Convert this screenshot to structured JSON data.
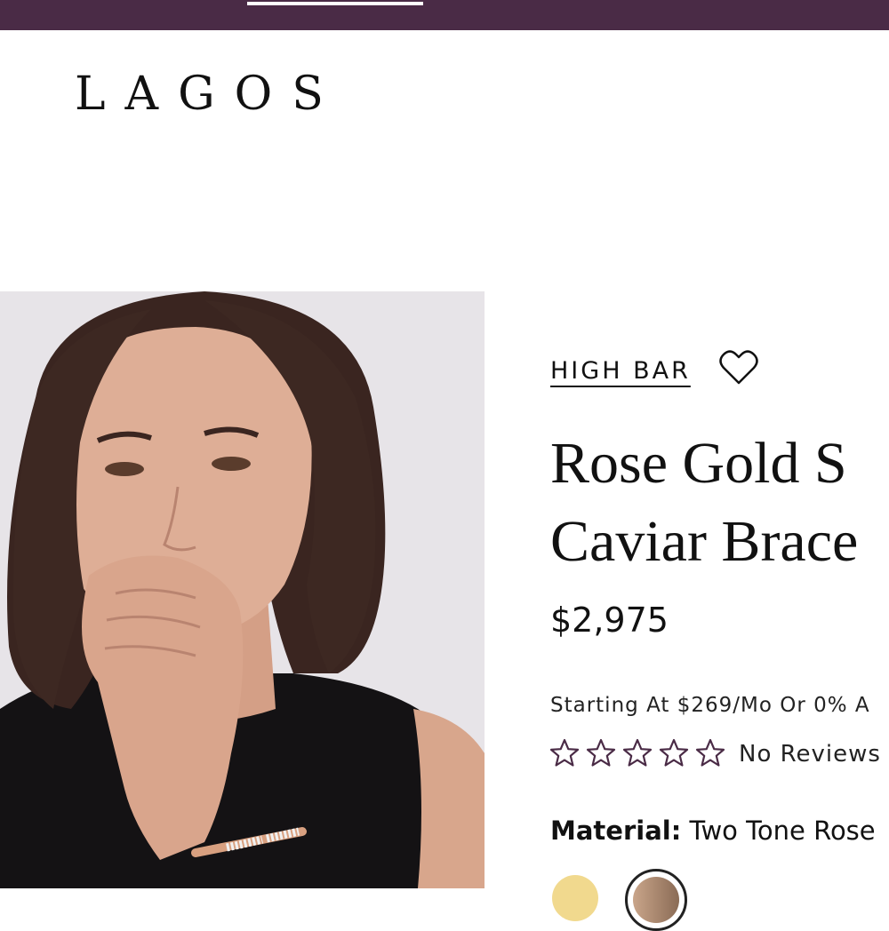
{
  "header": {
    "logo_text": "LAGOS",
    "bar_color": "#4a2b46"
  },
  "product": {
    "collection": "HIGH BAR",
    "title_line1": "Rose Gold S",
    "title_line2": "Caviar Brace",
    "price": "$2,975",
    "financing": "Starting At $269/Mo Or 0% A",
    "rating": 0,
    "rating_max": 5,
    "reviews": "No Reviews",
    "material_label": "Material:",
    "material_value": "Two Tone Rose",
    "icons": {
      "wishlist": "heart-outline-icon",
      "star": "star-outline-icon"
    },
    "star_color": "#4a2b46",
    "swatches": [
      {
        "name": "gold",
        "color": "#f1d98e",
        "selected": false
      },
      {
        "name": "two-tone-rose",
        "color": "#a8866e",
        "selected": true
      }
    ]
  }
}
